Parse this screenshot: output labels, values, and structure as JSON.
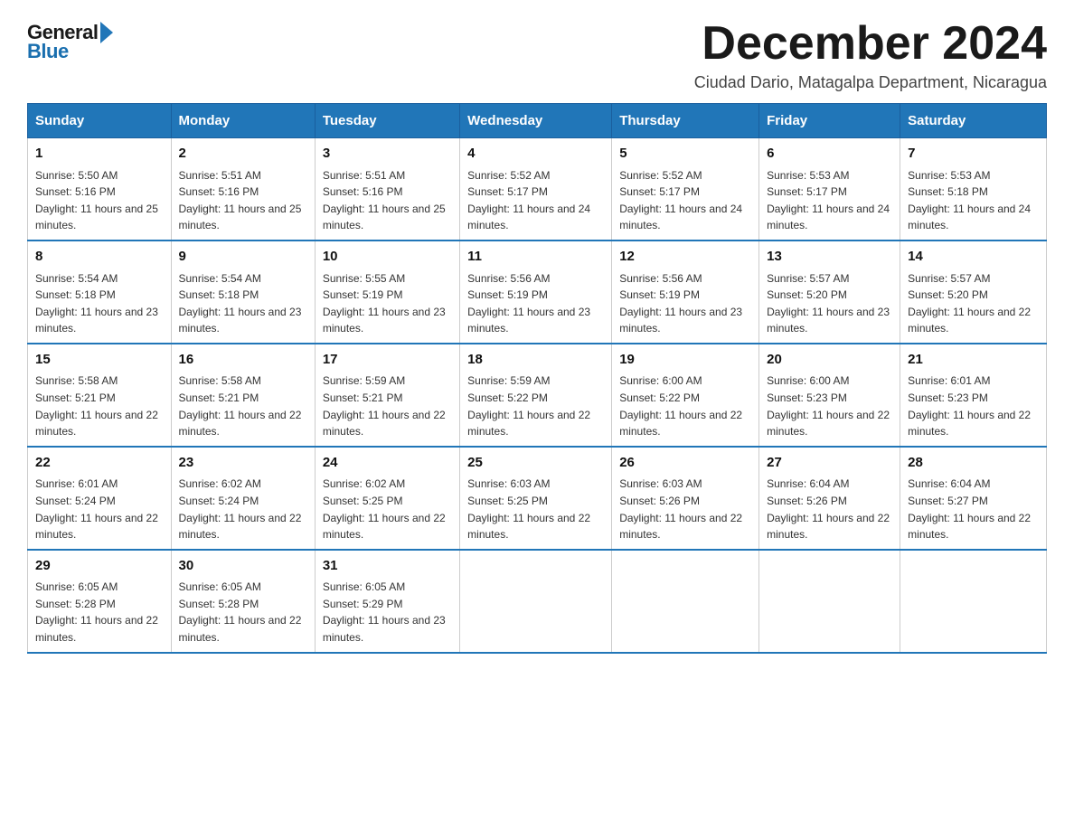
{
  "logo": {
    "line1": "General",
    "line2": "Blue",
    "arrow": "▶"
  },
  "title": "December 2024",
  "subtitle": "Ciudad Dario, Matagalpa Department, Nicaragua",
  "days_of_week": [
    "Sunday",
    "Monday",
    "Tuesday",
    "Wednesday",
    "Thursday",
    "Friday",
    "Saturday"
  ],
  "weeks": [
    [
      {
        "day": 1,
        "sunrise": "5:50 AM",
        "sunset": "5:16 PM",
        "daylight": "11 hours and 25 minutes."
      },
      {
        "day": 2,
        "sunrise": "5:51 AM",
        "sunset": "5:16 PM",
        "daylight": "11 hours and 25 minutes."
      },
      {
        "day": 3,
        "sunrise": "5:51 AM",
        "sunset": "5:16 PM",
        "daylight": "11 hours and 25 minutes."
      },
      {
        "day": 4,
        "sunrise": "5:52 AM",
        "sunset": "5:17 PM",
        "daylight": "11 hours and 24 minutes."
      },
      {
        "day": 5,
        "sunrise": "5:52 AM",
        "sunset": "5:17 PM",
        "daylight": "11 hours and 24 minutes."
      },
      {
        "day": 6,
        "sunrise": "5:53 AM",
        "sunset": "5:17 PM",
        "daylight": "11 hours and 24 minutes."
      },
      {
        "day": 7,
        "sunrise": "5:53 AM",
        "sunset": "5:18 PM",
        "daylight": "11 hours and 24 minutes."
      }
    ],
    [
      {
        "day": 8,
        "sunrise": "5:54 AM",
        "sunset": "5:18 PM",
        "daylight": "11 hours and 23 minutes."
      },
      {
        "day": 9,
        "sunrise": "5:54 AM",
        "sunset": "5:18 PM",
        "daylight": "11 hours and 23 minutes."
      },
      {
        "day": 10,
        "sunrise": "5:55 AM",
        "sunset": "5:19 PM",
        "daylight": "11 hours and 23 minutes."
      },
      {
        "day": 11,
        "sunrise": "5:56 AM",
        "sunset": "5:19 PM",
        "daylight": "11 hours and 23 minutes."
      },
      {
        "day": 12,
        "sunrise": "5:56 AM",
        "sunset": "5:19 PM",
        "daylight": "11 hours and 23 minutes."
      },
      {
        "day": 13,
        "sunrise": "5:57 AM",
        "sunset": "5:20 PM",
        "daylight": "11 hours and 23 minutes."
      },
      {
        "day": 14,
        "sunrise": "5:57 AM",
        "sunset": "5:20 PM",
        "daylight": "11 hours and 22 minutes."
      }
    ],
    [
      {
        "day": 15,
        "sunrise": "5:58 AM",
        "sunset": "5:21 PM",
        "daylight": "11 hours and 22 minutes."
      },
      {
        "day": 16,
        "sunrise": "5:58 AM",
        "sunset": "5:21 PM",
        "daylight": "11 hours and 22 minutes."
      },
      {
        "day": 17,
        "sunrise": "5:59 AM",
        "sunset": "5:21 PM",
        "daylight": "11 hours and 22 minutes."
      },
      {
        "day": 18,
        "sunrise": "5:59 AM",
        "sunset": "5:22 PM",
        "daylight": "11 hours and 22 minutes."
      },
      {
        "day": 19,
        "sunrise": "6:00 AM",
        "sunset": "5:22 PM",
        "daylight": "11 hours and 22 minutes."
      },
      {
        "day": 20,
        "sunrise": "6:00 AM",
        "sunset": "5:23 PM",
        "daylight": "11 hours and 22 minutes."
      },
      {
        "day": 21,
        "sunrise": "6:01 AM",
        "sunset": "5:23 PM",
        "daylight": "11 hours and 22 minutes."
      }
    ],
    [
      {
        "day": 22,
        "sunrise": "6:01 AM",
        "sunset": "5:24 PM",
        "daylight": "11 hours and 22 minutes."
      },
      {
        "day": 23,
        "sunrise": "6:02 AM",
        "sunset": "5:24 PM",
        "daylight": "11 hours and 22 minutes."
      },
      {
        "day": 24,
        "sunrise": "6:02 AM",
        "sunset": "5:25 PM",
        "daylight": "11 hours and 22 minutes."
      },
      {
        "day": 25,
        "sunrise": "6:03 AM",
        "sunset": "5:25 PM",
        "daylight": "11 hours and 22 minutes."
      },
      {
        "day": 26,
        "sunrise": "6:03 AM",
        "sunset": "5:26 PM",
        "daylight": "11 hours and 22 minutes."
      },
      {
        "day": 27,
        "sunrise": "6:04 AM",
        "sunset": "5:26 PM",
        "daylight": "11 hours and 22 minutes."
      },
      {
        "day": 28,
        "sunrise": "6:04 AM",
        "sunset": "5:27 PM",
        "daylight": "11 hours and 22 minutes."
      }
    ],
    [
      {
        "day": 29,
        "sunrise": "6:05 AM",
        "sunset": "5:28 PM",
        "daylight": "11 hours and 22 minutes."
      },
      {
        "day": 30,
        "sunrise": "6:05 AM",
        "sunset": "5:28 PM",
        "daylight": "11 hours and 22 minutes."
      },
      {
        "day": 31,
        "sunrise": "6:05 AM",
        "sunset": "5:29 PM",
        "daylight": "11 hours and 23 minutes."
      },
      null,
      null,
      null,
      null
    ]
  ]
}
